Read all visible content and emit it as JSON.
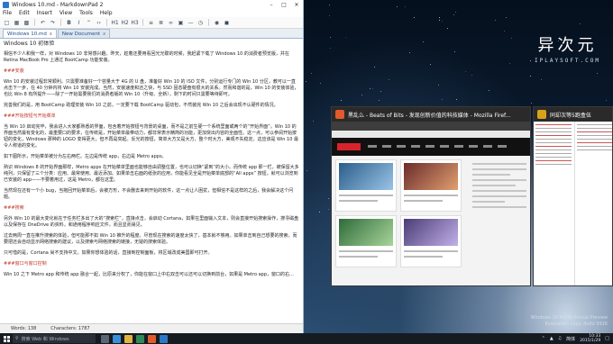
{
  "editor": {
    "window_title": "Windows 10.md - MarkdownPad 2",
    "menu": [
      "File",
      "Edit",
      "Insert",
      "View",
      "Tools",
      "Help"
    ],
    "tabs": [
      {
        "label": "Windows 10.md",
        "close": "x"
      },
      {
        "label": "New Document",
        "close": "x"
      }
    ],
    "paragraphs": [
      {
        "style": "title",
        "text": "Windows 10 初体验"
      },
      {
        "style": "body",
        "text": "相信不少人和我一样，对 Windows 10 非常感兴趣。昨天，趁着还要用看回光光碟的时候，我赶紧下载了 Windows 10 的消费者预览版，并在 Retina MacBook Pro 上通过 BootCamp 功能安装。"
      },
      {
        "style": "heading",
        "text": "###安装"
      },
      {
        "style": "body",
        "text": "Win 10 的安装过程非常顺利。只需要准备好一个容量大于 4G 的 U 盘，准备好 Win 10 的 ISO 文件，分别运行专门的 Win 10 分区，教可以一直点击下一步，在 40 分钟内将 Win 10 安装完成。当然，安装速度和还之快，与 SSD 固态硬盘有很大的关系。然而和谐的是，Win 10 的安装体验，也比 Win 8 有所提升——除了一开始需要我们的消费者版的 Win 10（升级、全新），剩下的时间只需要等待即可。"
      },
      {
        "style": "body",
        "text": "完善我们的是，用 BootCamp 助理安装 Win 10 之前，一定要下载 BootCamp 驱动包，不然装完 Win 10 之后会出现不认硬件的情况。"
      },
      {
        "style": "heading",
        "text": "###开始按钮与开始菜单"
      },
      {
        "style": "body",
        "text": "当 Win 10 启动完毕，我会进入大家都熟悉的界面，包含着开始按钮与背景的桌面，而不是之前生硬一个系统里面或两个的“开始界面”。Win 10 的界面当然最有变化的，最重要口的要求，在传统是，开始菜单最带动力，都非常表示精简的功能，更加突出内容的全面性。这一点，可以参阅开始按钮的变化，Windows 那种的 LOGO 变得更大，但不再是突起。反光的按钮，简单大方又是大方，整个时大方，美观不失稳定。这应该是 Win 10 最令人称道的变化。"
      },
      {
        "style": "body",
        "text": "如下图所示，开始菜单被分为左右两栏。左边是传统 app，右边是 Metro apps。"
      },
      {
        "style": "body",
        "text": "熟识 Windows 8 的开始界面那样，Metro apps 在开始菜单里面也能够自由调整位置，也可以切换“紧到”的大小。而传统 app 那一栏，被保留大多纯列，只保留了三个分类：应用、最常使用、最近添加。如果单击右面的纸张的应用，你能看见全是开始菜单底部的“All apps” 按钮，就可以浏览到已安装的 app——不要着用过，这是 Metro，都在这里。"
      },
      {
        "style": "body",
        "text": "当然现在还有一个小 bug，当拖回开始菜单后，会被方形，不会删去来到开始的软件，这一点让人困扰，但相信不是这样的之后，我会解决这个问题。"
      },
      {
        "style": "heading",
        "text": "###搜索"
      },
      {
        "style": "body",
        "text": "另外 Win 10 的最大变化就在于任务栏多出了大的“搜索栏”，直接点击，会启动 Cortana，如果在里面输入文本，则会直接开始搜索操作，搜寻磁盘以及保存在 OneDrive 的资料，和通用程序响应文件，而且显而易见。"
      },
      {
        "style": "body",
        "text": "过去两周一直在推升搜索的体验，但可能那不如 Win 10 推升的程度。尽管现在搜索的速度太快了，基本就不够用。如果单击到自己想要的搜索，而要把还会自动显示网络搜索的建议，以及搜索与网络搜索的链接，无疑的搜索体验。"
      },
      {
        "style": "body",
        "text": "只可惜的是，Cortana 尚不支持中文。如果你想体验的话，直接到控制面板，将区域改成美国即可打开。"
      },
      {
        "style": "heading",
        "text": "###窗口与窗口控制"
      },
      {
        "style": "body",
        "text": "Win 10 之下 Metro app 和传统 app 融合一起，比原来分权了，你能在窗口上中右双击可以还可以切换到前台，如果是 Metro app，窗口的右..."
      }
    ],
    "status": {
      "words": "Words: 138",
      "characters": "Characters: 1787"
    }
  },
  "desktop": {
    "logo_cn": "异次元",
    "logo_en": "IPLAYSOFT.COM",
    "watermark_line1": "Windows 10 Pro Technical Preview",
    "watermark_line2": "Evaluation copy. Build 9926"
  },
  "switcher": {
    "items": [
      {
        "title": "黑乱么 - Beats of Bits - 发现创新价值的科技媒体 - Mozilla Firef...",
        "color": "#e05a2b"
      },
      {
        "title": "同却次等5跑盒伍",
        "color": "#d9a21b"
      }
    ]
  },
  "taskbar": {
    "search_placeholder": "搜索 Web 和 Windows",
    "lang": "简体",
    "time": "10:33",
    "date": "2015/1/29"
  }
}
